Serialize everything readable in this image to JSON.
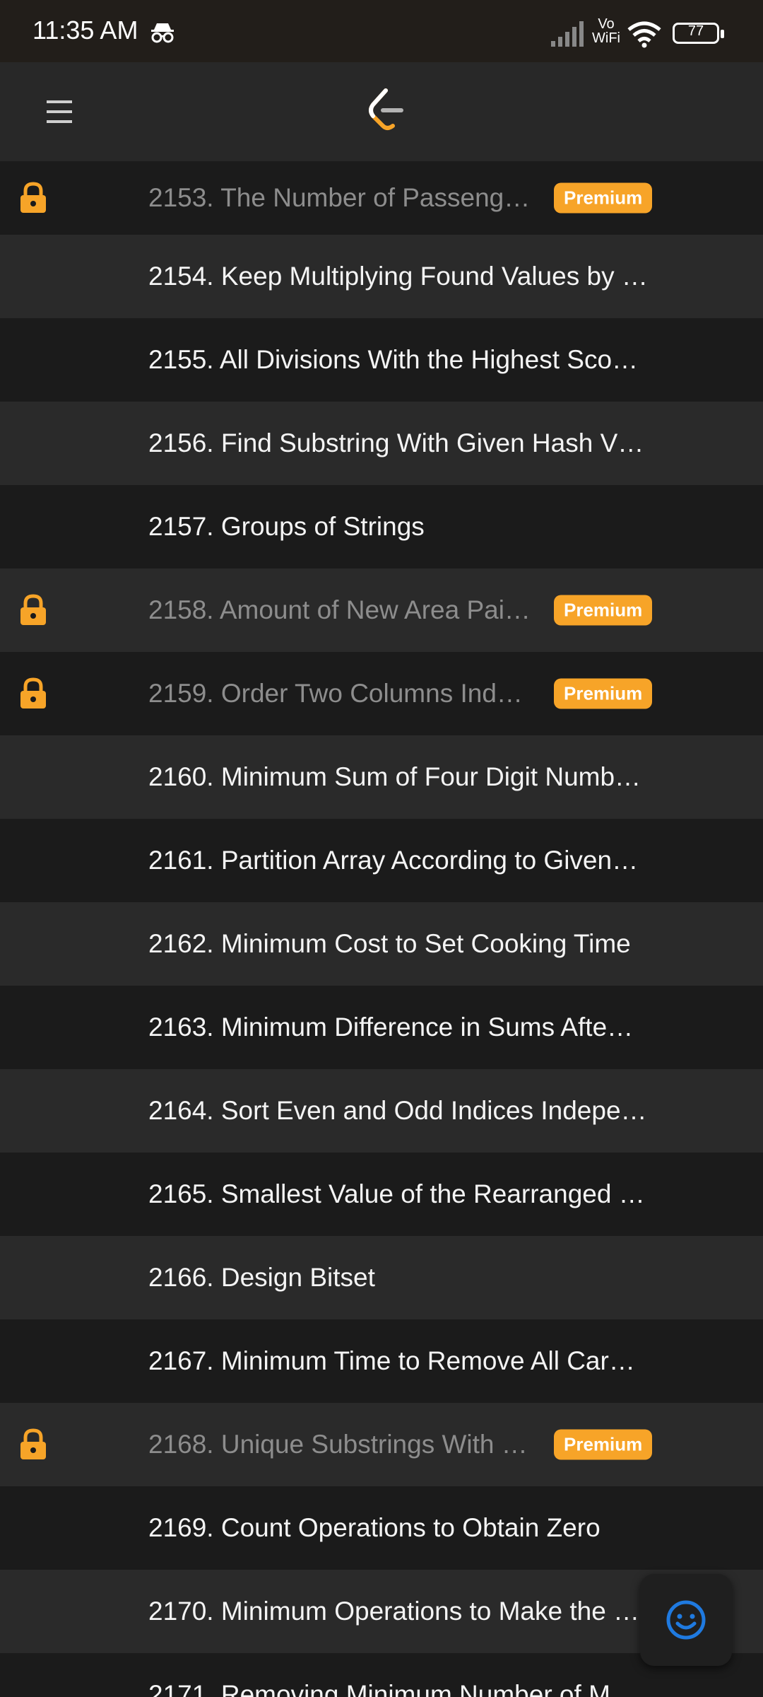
{
  "status_bar": {
    "time": "11:35 AM",
    "vowifi_top": "Vo",
    "vowifi_bottom": "WiFi",
    "battery": "77",
    "icons": [
      "incognito-icon",
      "signal-icon",
      "wifi-icon",
      "battery-icon"
    ]
  },
  "app_bar": {
    "icons": [
      "hamburger-menu-icon",
      "leetcode-logo"
    ]
  },
  "colors": {
    "accent": "#f7a428",
    "row_dark": "#1b1b1b",
    "row_light": "#2a2a2a",
    "fab_icon": "#1f7ae0"
  },
  "problems": [
    {
      "title": "2153. The Number of Passeng…",
      "locked": true,
      "badge": "Premium"
    },
    {
      "title": "2154. Keep Multiplying Found Values by …",
      "locked": false
    },
    {
      "title": "2155. All Divisions With the Highest Sco…",
      "locked": false
    },
    {
      "title": "2156. Find Substring With Given Hash V…",
      "locked": false
    },
    {
      "title": "2157. Groups of Strings",
      "locked": false
    },
    {
      "title": "2158. Amount of New Area Pai…",
      "locked": true,
      "badge": "Premium"
    },
    {
      "title": "2159. Order Two Columns Ind…",
      "locked": true,
      "badge": "Premium"
    },
    {
      "title": "2160. Minimum Sum of Four Digit Numb…",
      "locked": false
    },
    {
      "title": "2161. Partition Array According to Given…",
      "locked": false
    },
    {
      "title": "2162. Minimum Cost to Set Cooking Time",
      "locked": false
    },
    {
      "title": "2163. Minimum Difference in Sums Afte…",
      "locked": false
    },
    {
      "title": "2164. Sort Even and Odd Indices Indepe…",
      "locked": false
    },
    {
      "title": "2165. Smallest Value of the Rearranged …",
      "locked": false
    },
    {
      "title": "2166. Design Bitset",
      "locked": false
    },
    {
      "title": "2167. Minimum Time to Remove All Car…",
      "locked": false
    },
    {
      "title": "2168. Unique Substrings With …",
      "locked": true,
      "badge": "Premium"
    },
    {
      "title": "2169. Count Operations to Obtain Zero",
      "locked": false
    },
    {
      "title": "2170. Minimum Operations to Make the …",
      "locked": false
    },
    {
      "title": "2171. Removing Minimum Number of M…",
      "locked": false
    }
  ],
  "fab": {
    "icon": "smiley-feedback-icon"
  }
}
